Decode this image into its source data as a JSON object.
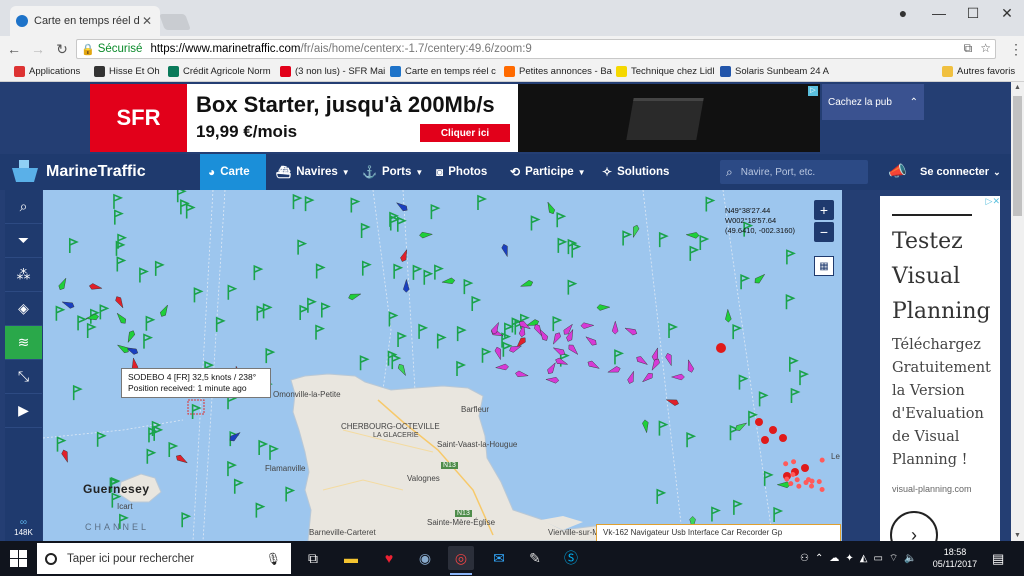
{
  "browser": {
    "tab_title": "Carte en temps réel des n",
    "secure_label": "Sécurisé",
    "url_domain": "https://www.marinetraffic.com",
    "url_path": "/fr/ais/home/centerx:-1.7/centery:49.6/zoom:9",
    "bookmarks": [
      {
        "label": "Applications",
        "color": "#d33"
      },
      {
        "label": "Hisse Et Oh",
        "color": "#333"
      },
      {
        "label": "Crédit Agricole Norm",
        "color": "#0a7a5a"
      },
      {
        "label": "(3 non lus) - SFR Mai",
        "color": "#e2001a"
      },
      {
        "label": "Carte en temps réel c",
        "color": "#1e73c9"
      },
      {
        "label": "Petites annonces - Ba",
        "color": "#ff6a00"
      },
      {
        "label": "Technique chez Lidl",
        "color": "#f5d800"
      },
      {
        "label": "Solaris Sunbeam 24 A",
        "color": "#2255aa"
      }
    ],
    "other_bookmarks": "Autres favoris"
  },
  "ad_top": {
    "brand": "SFR",
    "headline": "Box Starter, jusqu'à 200Mb/s",
    "price": "19,99 €/mois",
    "cta": "Cliquer ici",
    "hide_label": "Cachez la pub"
  },
  "nav": {
    "brand": "MarineTraffic",
    "items": [
      "Carte",
      "Navires",
      "Ports",
      "Photos",
      "Participe",
      "Solutions"
    ],
    "search_placeholder": "Navire, Port, etc.",
    "login": "Se connecter"
  },
  "sidebar": {
    "vessel_count": "148K"
  },
  "map": {
    "coords_line1": "N49°38'27.44",
    "coords_line2": "W002°18'57.64",
    "coords_line3": "(49.6410, -002.3160)",
    "tooltip_line1": "SODEBO 4 [FR] 32,5 knots / 238°",
    "tooltip_line2": "Position received: 1 minute ago",
    "places": {
      "omonville": "Omonville-la-Petite",
      "cherbourg": "CHERBOURG-OCTEVILLE",
      "glacerie": "LA GLACERIE",
      "barfleur": "Barfleur",
      "st_vaast": "Saint-Vaast-la-Hougue",
      "flamanville": "Flamanville",
      "valognes": "Valognes",
      "guernsey": "Guernesey",
      "icart": "Icart",
      "channel": "CHANNEL",
      "ste_mere": "Sainte-Mère-Église",
      "barneville": "Barneville-Carteret",
      "vierville": "Vierville-sur-Mer",
      "le": "Le"
    },
    "road_n13": "N13",
    "bottom_ad": "Vk-162 Navigateur Usb Interface Car Recorder Gp"
  },
  "side_ad": {
    "title": "Testez Visual Planning",
    "body": "Téléchargez Gratuitement la Version d'Evaluation de Visual Planning !",
    "domain": "visual-planning.com"
  },
  "taskbar": {
    "search_placeholder": "Taper ici pour rechercher",
    "time": "18:58",
    "date": "05/11/2017"
  }
}
